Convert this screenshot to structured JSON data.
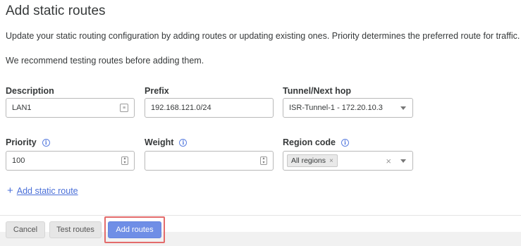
{
  "page": {
    "title": "Add static routes",
    "description": "Update your static routing configuration by adding routes or updating existing ones. Priority determines the preferred route for traffic.",
    "recommendation": "We recommend testing routes before adding them."
  },
  "form": {
    "description": {
      "label": "Description",
      "value": "LAN1",
      "icon": "contact-card-icon"
    },
    "prefix": {
      "label": "Prefix",
      "value": "192.168.121.0/24"
    },
    "tunnel": {
      "label": "Tunnel/Next hop",
      "value": "ISR-Tunnel-1 - 172.20.10.3"
    },
    "priority": {
      "label": "Priority",
      "value": "100",
      "info_icon": "info-icon"
    },
    "weight": {
      "label": "Weight",
      "value": "",
      "info_icon": "info-icon"
    },
    "region": {
      "label": "Region code",
      "chip": "All regions",
      "chip_remove": "×",
      "clear": "×",
      "info_icon": "info-icon"
    }
  },
  "actions": {
    "add_static_route": "Add static route",
    "add_static_route_icon": "+",
    "cancel": "Cancel",
    "test_routes": "Test routes",
    "add_routes": "Add routes"
  },
  "colors": {
    "accent": "#6f8ee6",
    "link": "#4a6fd8",
    "highlight": "#e36b6b",
    "text": "#36393a"
  }
}
